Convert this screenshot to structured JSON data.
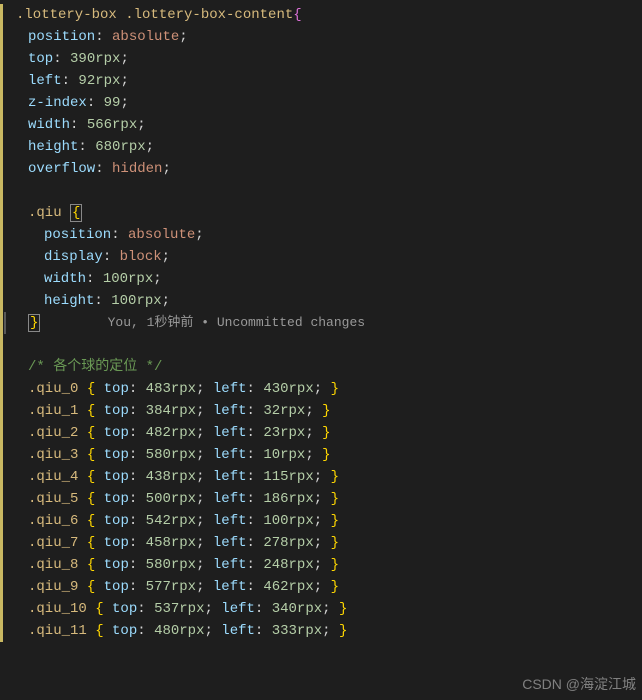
{
  "rule1": {
    "selector": ".lottery-box .lottery-box-content",
    "props": [
      {
        "name": "position",
        "value": "absolute",
        "type": "kw"
      },
      {
        "name": "top",
        "value": "390",
        "unit": "rpx"
      },
      {
        "name": "left",
        "value": "92",
        "unit": "rpx"
      },
      {
        "name": "z-index",
        "value": "99",
        "unit": ""
      },
      {
        "name": "width",
        "value": "566",
        "unit": "rpx"
      },
      {
        "name": "height",
        "value": "680",
        "unit": "rpx"
      },
      {
        "name": "overflow",
        "value": "hidden",
        "type": "kw"
      }
    ]
  },
  "rule2": {
    "selector": ".qiu",
    "props": [
      {
        "name": "position",
        "value": "absolute",
        "type": "kw"
      },
      {
        "name": "display",
        "value": "block",
        "type": "kw"
      },
      {
        "name": "width",
        "value": "100",
        "unit": "rpx"
      },
      {
        "name": "height",
        "value": "100",
        "unit": "rpx"
      }
    ]
  },
  "codelens": "You, 1秒钟前 • Uncommitted changes",
  "comment": "/* 各个球的定位 */",
  "qiuRules": [
    {
      "sel": ".qiu_0",
      "top": "483",
      "left": "430"
    },
    {
      "sel": ".qiu_1",
      "top": "384",
      "left": "32"
    },
    {
      "sel": ".qiu_2",
      "top": "482",
      "left": "23"
    },
    {
      "sel": ".qiu_3",
      "top": "580",
      "left": "10"
    },
    {
      "sel": ".qiu_4",
      "top": "438",
      "left": "115"
    },
    {
      "sel": ".qiu_5",
      "top": "500",
      "left": "186"
    },
    {
      "sel": ".qiu_6",
      "top": "542",
      "left": "100"
    },
    {
      "sel": ".qiu_7",
      "top": "458",
      "left": "278"
    },
    {
      "sel": ".qiu_8",
      "top": "580",
      "left": "248"
    },
    {
      "sel": ".qiu_9",
      "top": "577",
      "left": "462"
    },
    {
      "sel": ".qiu_10",
      "top": "537",
      "left": "340"
    },
    {
      "sel": ".qiu_11",
      "top": "480",
      "left": "333"
    }
  ],
  "watermark": "CSDN @海淀江城"
}
